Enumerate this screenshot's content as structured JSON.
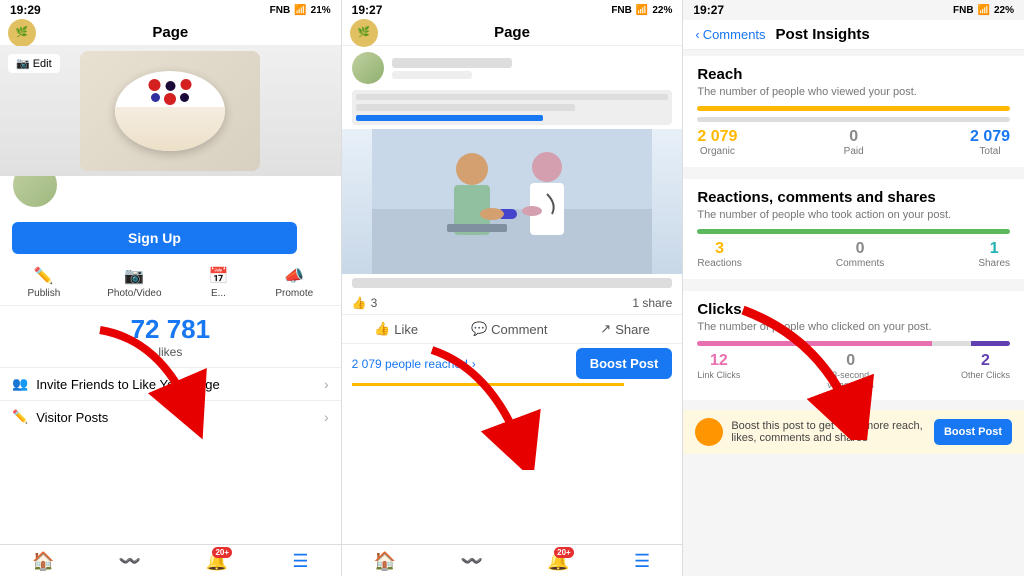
{
  "panel1": {
    "status_time": "19:29",
    "carrier": "FNB",
    "battery": "21%",
    "title": "Page",
    "edit_label": "Edit",
    "signup_label": "Sign Up",
    "publish_label": "Publish",
    "photo_video_label": "Photo/Video",
    "events_label": "E...",
    "promote_label": "Promote",
    "likes_count": "72 781",
    "likes_label": "likes",
    "invite_friends_label": "Invite Friends to Like Your Page",
    "visitor_posts_label": "Visitor Posts"
  },
  "panel2": {
    "status_time": "19:27",
    "carrier": "FNB",
    "battery": "22%",
    "title": "Page",
    "reactions_count": "3",
    "shares_count": "1 share",
    "like_label": "Like",
    "comment_label": "Comment",
    "share_label": "Share",
    "reach_text": "2 079 people reached",
    "boost_label": "Boost Post"
  },
  "panel3": {
    "status_time": "19:27",
    "carrier": "FNB",
    "battery": "22%",
    "back_label": "Comments",
    "title": "Post Insights",
    "reach_section": {
      "title": "Reach",
      "subtitle": "The number of people who viewed your post.",
      "organic_val": "2 079",
      "organic_label": "Organic",
      "paid_val": "0",
      "paid_label": "Paid",
      "total_val": "2 079",
      "total_label": "Total"
    },
    "reactions_section": {
      "title": "Reactions, comments and shares",
      "subtitle": "The number of people who took action on your post.",
      "reactions_val": "3",
      "reactions_label": "Reactions",
      "comments_val": "0",
      "comments_label": "Comments",
      "shares_val": "1",
      "shares_label": "Shares"
    },
    "clicks_section": {
      "title": "Clicks",
      "subtitle": "The number of people who clicked on your post.",
      "link_val": "12",
      "link_label": "Link Clicks",
      "video_val": "0",
      "video_label": "3-second video views",
      "other_val": "2",
      "other_label": "Other Clicks"
    },
    "boost_banner": "Boost this post to get even more reach, likes, comments and shares",
    "boost_label": "Boost Post"
  }
}
